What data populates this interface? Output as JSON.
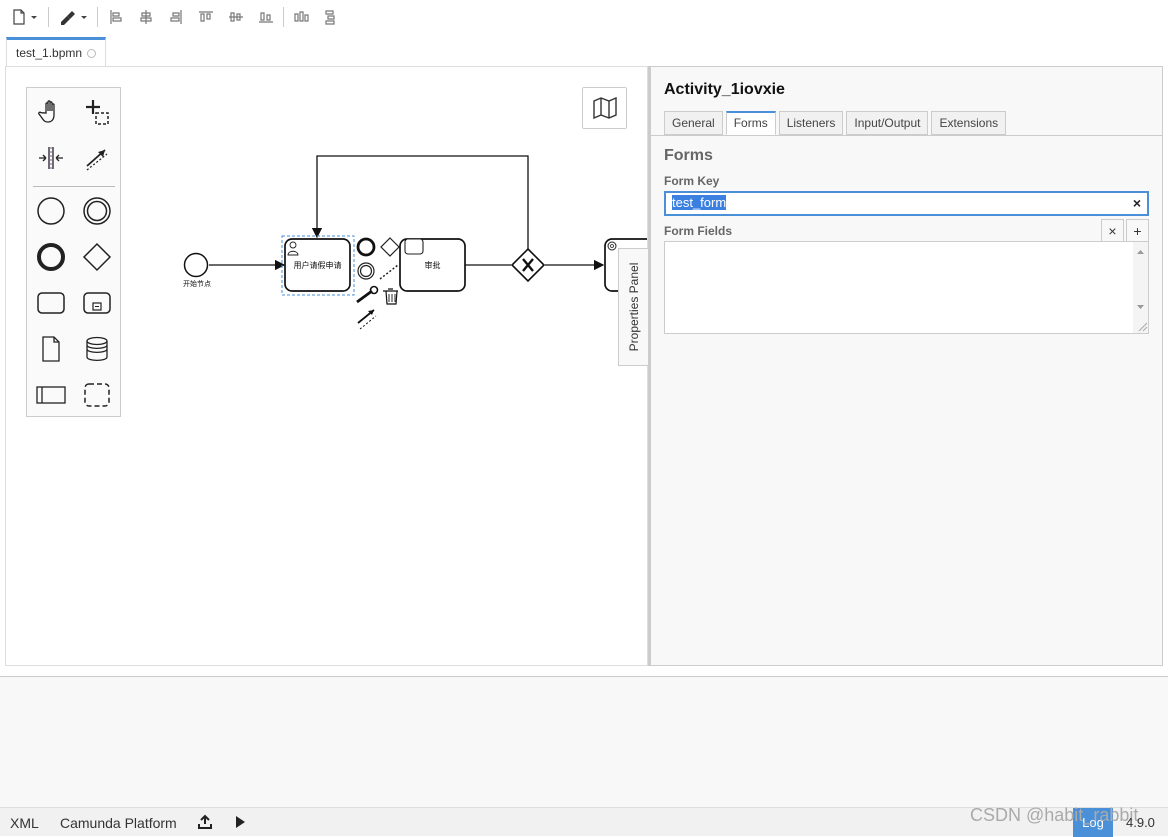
{
  "toolbar": {
    "icons": [
      "new-file-icon",
      "edit-brush-icon",
      "align-left-icon",
      "align-center-icon",
      "align-right-icon",
      "align-top-icon",
      "align-middle-icon",
      "align-bottom-icon",
      "distribute-horizontal-icon",
      "distribute-vertical-icon"
    ]
  },
  "file_tab": {
    "name": "test_1.bpmn"
  },
  "canvas": {
    "palette_icons": [
      "hand-tool-icon",
      "lasso-tool-icon",
      "space-tool-icon",
      "connect-tool-icon",
      "start-event-icon",
      "intermediate-event-icon",
      "end-event-icon",
      "gateway-icon",
      "task-icon",
      "subprocess-icon",
      "data-object-icon",
      "data-store-icon",
      "pool-icon",
      "group-icon"
    ],
    "diagram": {
      "start_label": "开始节点",
      "task1_label": "用户请假申请",
      "task2_label": "审批"
    },
    "properties_toggle": "Properties Panel"
  },
  "properties": {
    "element_id": "Activity_1iovxie",
    "tabs": [
      "General",
      "Forms",
      "Listeners",
      "Input/Output",
      "Extensions"
    ],
    "active_tab": "Forms",
    "section_title": "Forms",
    "form_key_label": "Form Key",
    "form_key_value": "test_form",
    "form_fields_label": "Form Fields",
    "clear_symbol": "×",
    "add_symbol": "+"
  },
  "status": {
    "xml": "XML",
    "platform": "Camunda Platform",
    "log": "Log",
    "version": "4.9.0",
    "watermark": "CSDN @habit_rabbit"
  }
}
